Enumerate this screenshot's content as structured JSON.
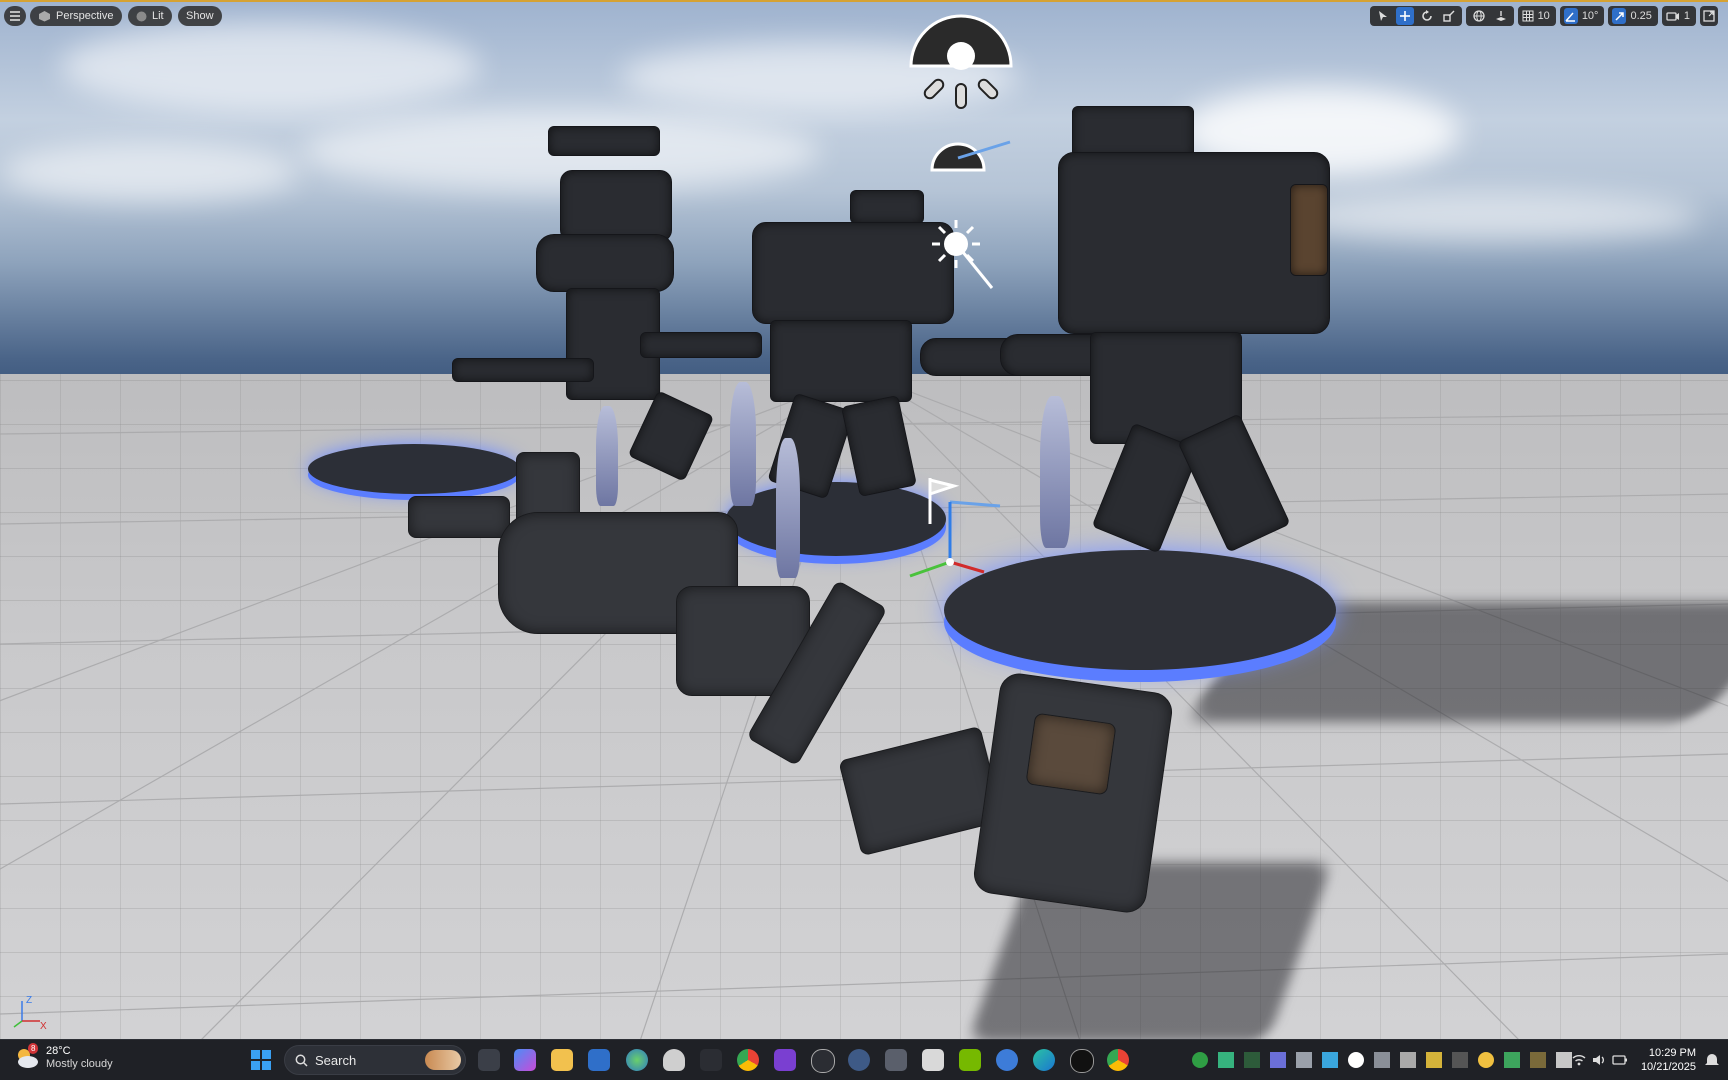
{
  "viewport": {
    "toolbar": {
      "menu_icon": "hamburger-icon",
      "perspective_label": "Perspective",
      "lit_label": "Lit",
      "show_label": "Show",
      "grid_snap_value": "10",
      "rotation_snap_value": "10°",
      "scale_snap_value": "0.25",
      "camera_speed_value": "1"
    },
    "axis_widget": {
      "z": "Z",
      "x": "X"
    }
  },
  "taskbar": {
    "weather": {
      "temperature": "28°C",
      "condition": "Mostly cloudy",
      "badge": "8"
    },
    "search_label": "Search",
    "clock": {
      "time": "10:29 PM",
      "date": "10/21/2025"
    }
  },
  "colors": {
    "accent": "#2f6fc9",
    "viewport_border": "#d6a233",
    "glow": "#5b7dff"
  }
}
